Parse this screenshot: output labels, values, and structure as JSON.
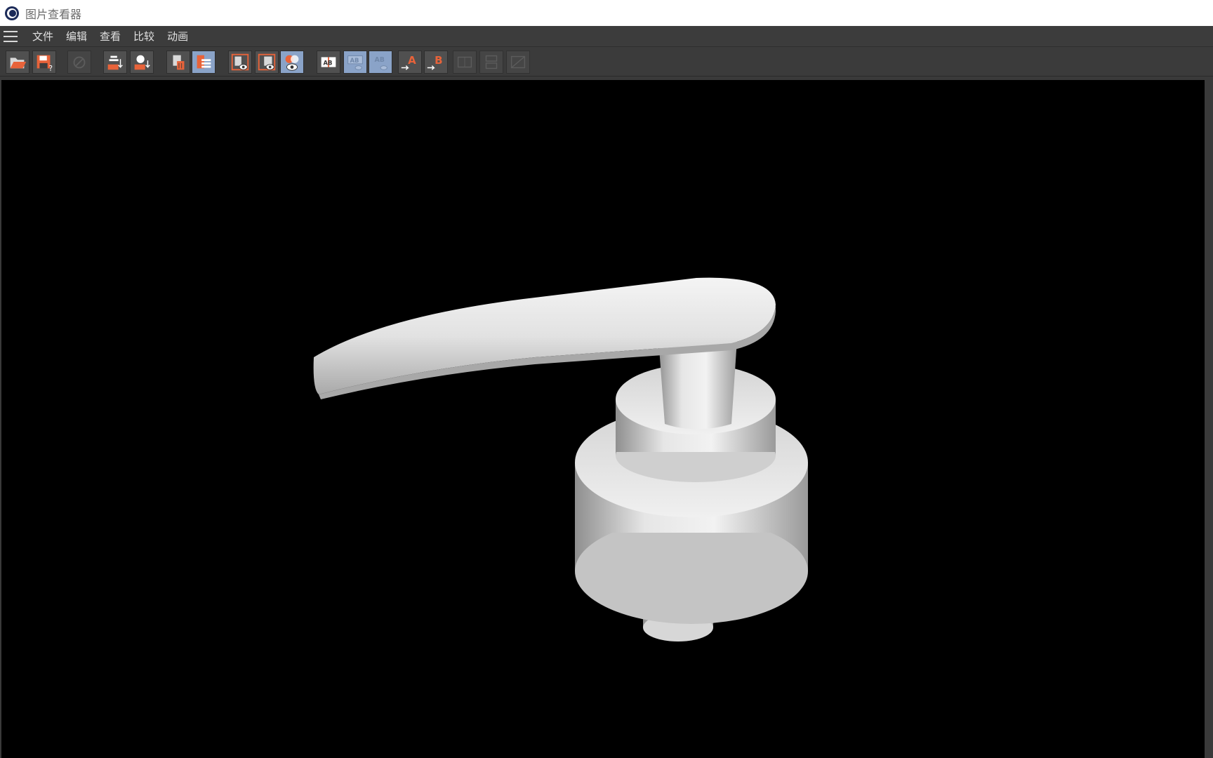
{
  "window": {
    "title": "图片查看器"
  },
  "menu": {
    "items": [
      "文件",
      "编辑",
      "查看",
      "比较",
      "动画"
    ]
  },
  "toolbar": {
    "compare_a_label": "A",
    "compare_b_label": "B",
    "ab_label": "AB"
  },
  "colors": {
    "accent_orange": "#e8633a",
    "active_blue": "#8aa3c8",
    "viewport_bg": "#000000"
  },
  "icons": {
    "menu": "hamburger-icon",
    "open": "open-folder-icon",
    "save": "save-icon",
    "stop": "stop-icon",
    "merge": "merge-layers-icon",
    "export": "export-icon",
    "delete": "delete-icon",
    "list": "list-icon",
    "view_a": "view-a-icon",
    "view_b": "view-b-icon",
    "view_ab": "view-ab-icon"
  }
}
